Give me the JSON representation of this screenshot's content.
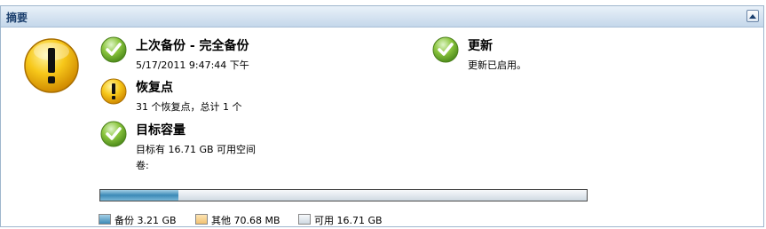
{
  "panel": {
    "title": "摘要"
  },
  "status": {
    "overall_icon": "warning-icon"
  },
  "last_backup": {
    "icon": "check-icon",
    "title": "上次备份 - 完全备份",
    "timestamp": "5/17/2011 9:47:44 下午"
  },
  "update": {
    "icon": "check-icon",
    "title": "更新",
    "detail": "更新已启用。"
  },
  "restore_points": {
    "icon": "warning-icon",
    "title": "恢复点",
    "detail": "31 个恢复点，总计 1 个"
  },
  "target_capacity": {
    "icon": "check-icon",
    "title": "目标容量",
    "detail": "目标有 16.71 GB 可用空间",
    "volume_label": "卷:"
  },
  "capacity": {
    "backup_fraction": 0.16,
    "other_fraction": 0.0,
    "legend": [
      {
        "label": "备份 3.21 GB",
        "color": "#3c8ab7"
      },
      {
        "label": "其他 70.68 MB",
        "color": "#f2c272"
      },
      {
        "label": "可用 16.71 GB",
        "color": "#dfe6ec"
      }
    ]
  }
}
